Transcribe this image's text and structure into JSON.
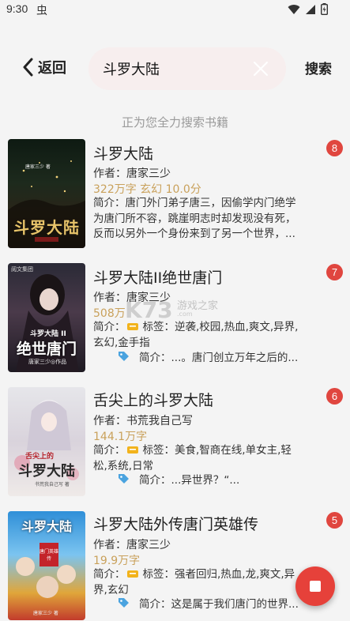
{
  "status_bar": {
    "time": "9:30",
    "notification_glyph": "虫"
  },
  "header": {
    "back_label": "返回",
    "search_value": "斗罗大陆",
    "search_label": "搜索"
  },
  "status_text": "正为您全力搜索书籍",
  "results": [
    {
      "title": "斗罗大陆",
      "badge": "8",
      "author": "作者：唐家三少",
      "meta": "322万字  玄幻  10.0分",
      "intro_lines": [
        "简介：唐门外门弟子唐三，因偷学内门绝学",
        "为唐门所不容，跳崖明志时却发现没有死，",
        "反而以另外一个身份来到了另一个世界，..."
      ],
      "cover_title": "斗罗大陆",
      "cover_author": "唐家三少 著"
    },
    {
      "title": "斗罗大陆II绝世唐门",
      "badge": "7",
      "author": "作者：唐家三少",
      "meta": "508万",
      "intro_prefix": "简介：",
      "tags_lines": [
        "标签：逆袭,校园,热血,爽文,异界,",
        "玄幻,金手指"
      ],
      "sub_intro": "简介：...。唐门创立万年之后的...",
      "cover_top": "阅文集团",
      "cover_title": "绝世唐门",
      "cover_sub": "斗罗大陆 II",
      "cover_author": "唐家三少◎作品"
    },
    {
      "title": "舌尖上的斗罗大陆",
      "badge": "6",
      "author": "作者：书荒我自己写",
      "meta": "144.1万字",
      "intro_prefix": "简介：",
      "tags_lines": [
        "标签：美食,智商在线,单女主,轻",
        "松,系统,日常"
      ],
      "sub_intro": "简介：...异世界？“...",
      "cover_title": "斗罗大陆",
      "cover_sub": "舌尖上的",
      "cover_author": "书荒我自己写 著"
    },
    {
      "title": "斗罗大陆外传唐门英雄传",
      "badge": "5",
      "author": "作者：唐家三少",
      "meta": "19.9万字",
      "intro_prefix": "简介：",
      "tags_lines": [
        "标签：强者回归,热血,龙,爽文,异",
        "界,玄幻"
      ],
      "sub_intro": "简介：这是属于我们唐门的世界...",
      "cover_title": "斗罗大陆",
      "cover_sub": "唐门英雄传",
      "cover_author": "唐家三少 著"
    }
  ],
  "watermark": {
    "brand": "K73",
    "text": "游戏之家",
    "url": ".com"
  },
  "colors": {
    "accent": "#e0463f",
    "meta": "#c9a15b",
    "background": "#f4f4f4"
  }
}
